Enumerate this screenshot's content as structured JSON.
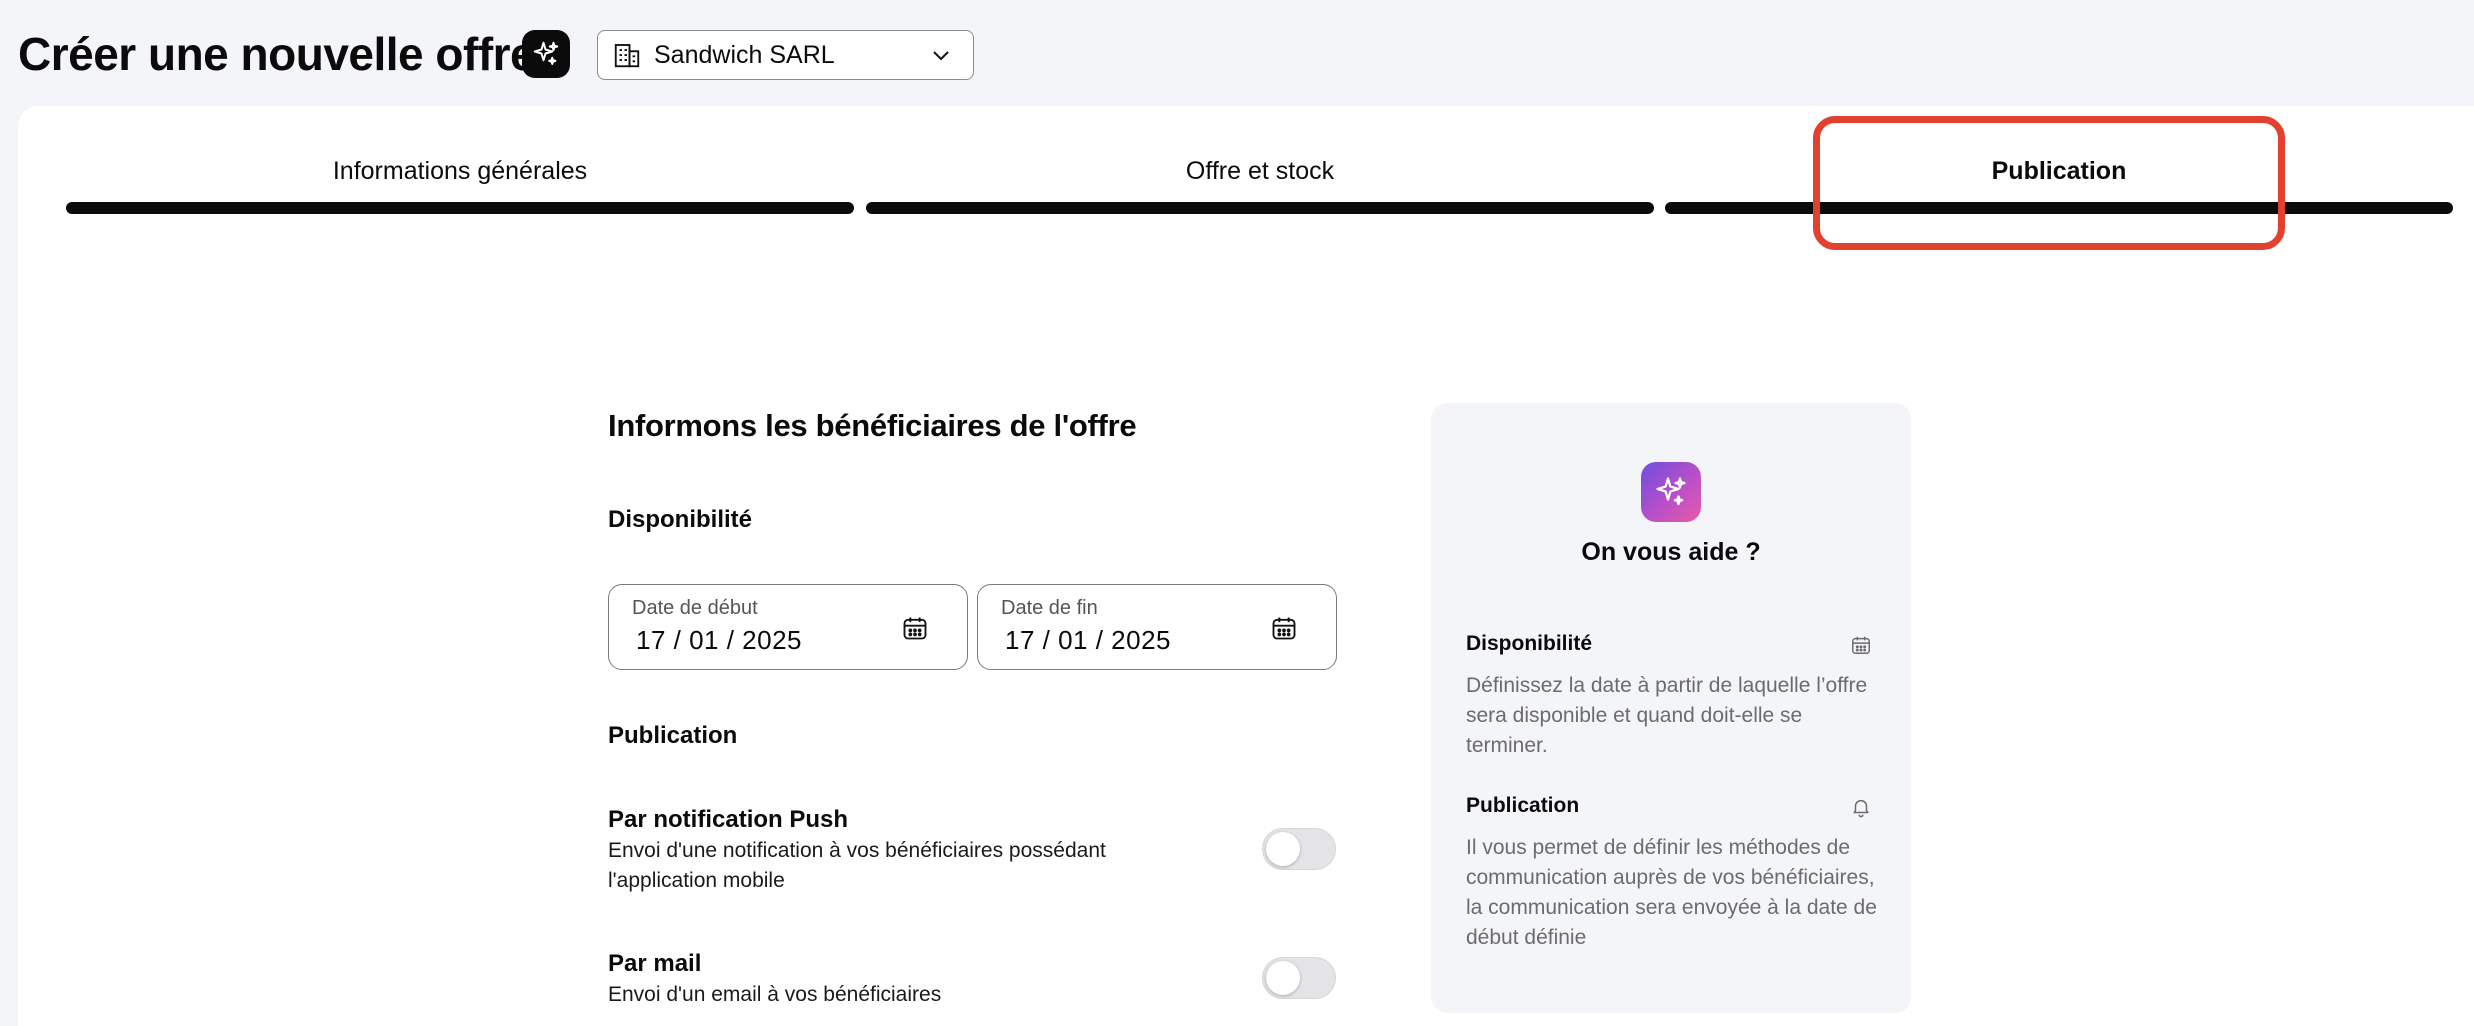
{
  "header": {
    "title": "Créer une nouvelle offre",
    "company": "Sandwich SARL"
  },
  "steps": [
    {
      "label": "Informations générales",
      "active": false
    },
    {
      "label": "Offre et stock",
      "active": false
    },
    {
      "label": "Publication",
      "active": true
    }
  ],
  "form": {
    "title": "Informons les bénéficiaires de l'offre",
    "availability_label": "Disponibilité",
    "start_date": {
      "label": "Date de début",
      "value": "17 / 01 / 2025"
    },
    "end_date": {
      "label": "Date de fin",
      "value": "17 / 01 / 2025"
    },
    "publication_label": "Publication",
    "push": {
      "title": "Par notification Push",
      "desc": "Envoi d'une notification à vos bénéficiaires possédant l'application mobile",
      "enabled": false
    },
    "mail": {
      "title": "Par mail",
      "desc": "Envoi d'un email à vos bénéficiaires",
      "enabled": false
    }
  },
  "help": {
    "title": "On vous aide ?",
    "sections": [
      {
        "title": "Disponibilité",
        "icon": "calendar-icon",
        "text": "Définissez la date à partir de laquelle l’offre sera disponible et quand doit-elle se terminer."
      },
      {
        "title": "Publication",
        "icon": "bell-icon",
        "text": "Il vous permet de définir les méthodes de communication auprès de vos bénéficiaires, la communication sera envoyée à la date de début définie"
      }
    ]
  },
  "colors": {
    "highlight": "#e3412f",
    "accent_gradient_start": "#6d4ee0",
    "accent_gradient_end": "#e95aa6"
  }
}
